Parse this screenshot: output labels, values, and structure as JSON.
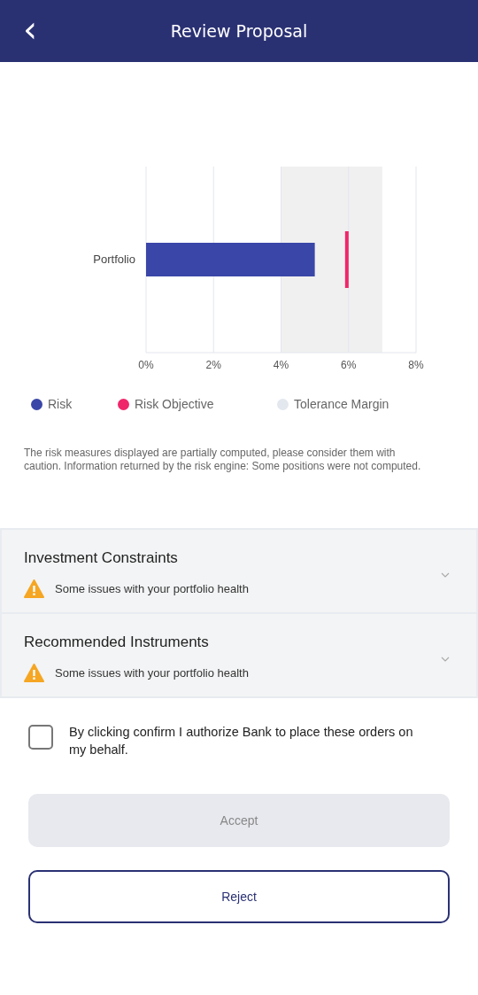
{
  "header": {
    "back_icon": "‹",
    "title": "Review Proposal"
  },
  "chart": {
    "chart_data": {
      "type": "bar",
      "orientation": "horizontal",
      "categories": [
        "Portfolio"
      ],
      "series": [
        {
          "name": "Risk",
          "color": "#3a46a8",
          "values": [
            5.0
          ]
        }
      ],
      "xlim": [
        0,
        8
      ],
      "xticks": [
        {
          "value": 0,
          "label": "0%"
        },
        {
          "value": 2,
          "label": "2%"
        },
        {
          "value": 4,
          "label": "4%"
        },
        {
          "value": 6,
          "label": "6%"
        },
        {
          "value": 8,
          "label": "8%"
        }
      ],
      "grid": true,
      "bands": [
        {
          "axis": "x",
          "from": 4,
          "to": 7,
          "label": "Tolerance Margin",
          "color": "#f0f0f0"
        }
      ],
      "ref_lines": [
        {
          "axis": "x",
          "value": 5.95,
          "label": "Risk Objective",
          "color": "#f0266a"
        }
      ]
    }
  },
  "note": "The risk measures displayed are partially computed,  please consider them with caution. Information returned by the risk engine: Some positions were not computed.",
  "sections": [
    {
      "title": "Investment Constraints",
      "warning": "Some issues with your portfolio health",
      "expanded": false
    },
    {
      "title": "Recommended Instruments",
      "warning": "Some issues with your portfolio health",
      "expanded": false
    }
  ],
  "consent": {
    "label": "By clicking confirm I authorize Bank to place these orders on my behalf.",
    "checked": false
  },
  "buttons": [
    {
      "label": "Accept",
      "kind": "primary",
      "disabled": true
    },
    {
      "label": "Reject",
      "kind": "outline"
    }
  ]
}
